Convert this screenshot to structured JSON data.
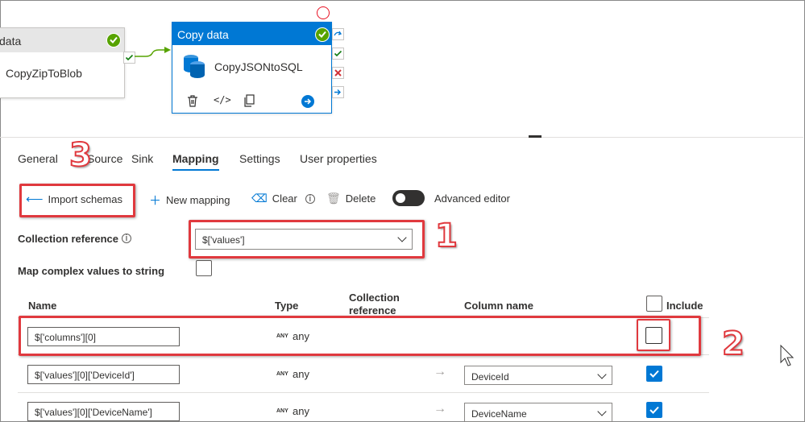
{
  "canvas": {
    "activity1": {
      "header": "data",
      "name": "CopyZipToBlob"
    },
    "activity2": {
      "header": "Copy data",
      "name": "CopyJSONtoSQL"
    }
  },
  "tabs": [
    "General",
    "Source",
    "Sink",
    "Mapping",
    "Settings",
    "User properties"
  ],
  "active_tab": "Mapping",
  "toolbar": {
    "import_schemas": "Import schemas",
    "new_mapping": "New mapping",
    "clear": "Clear",
    "delete": "Delete",
    "advanced_editor": "Advanced editor"
  },
  "collection_reference": {
    "label": "Collection reference",
    "value": "$['values']"
  },
  "map_complex": {
    "label": "Map complex values to string",
    "checked": false
  },
  "table": {
    "headers": {
      "name": "Name",
      "type": "Type",
      "collection_reference": "Collection reference",
      "column_name": "Column name",
      "include": "Include"
    },
    "rows": [
      {
        "name": "$['columns'][0]",
        "type_badge": "ANY",
        "type": "any",
        "column": "",
        "include": false
      },
      {
        "name": "$['values'][0]['DeviceId']",
        "type_badge": "ANY",
        "type": "any",
        "column": "DeviceId",
        "include": true
      },
      {
        "name": "$['values'][0]['DeviceName']",
        "type_badge": "ANY",
        "type": "any",
        "column": "DeviceName",
        "include": true
      }
    ]
  },
  "annotations": [
    "1",
    "2",
    "3"
  ],
  "colors": {
    "accent": "#0078d4",
    "success": "#57a300",
    "annotation": "#e0393e"
  }
}
